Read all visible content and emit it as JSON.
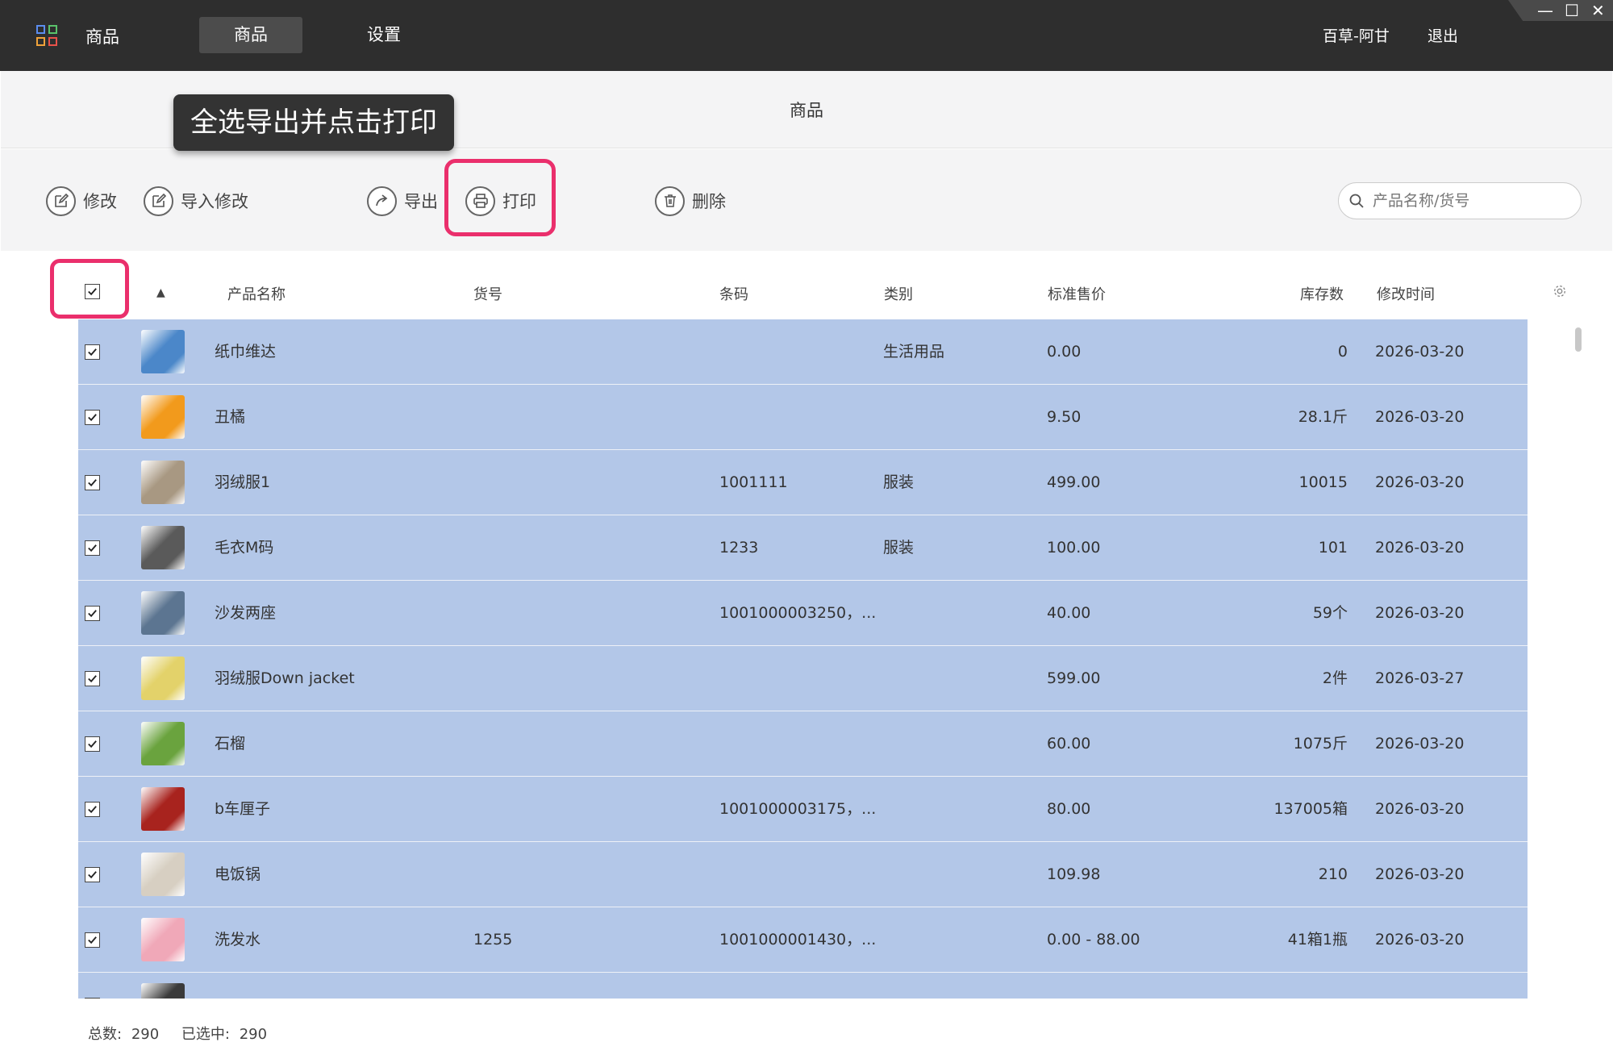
{
  "topbar": {
    "app_name": "商品",
    "tabs": [
      {
        "label": "商品",
        "active": true
      },
      {
        "label": "设置",
        "active": false
      }
    ],
    "user_name": "百草-阿甘",
    "logout_label": "退出",
    "window_controls": {
      "minimize": "—",
      "maximize": "☐",
      "close": "✕"
    }
  },
  "page": {
    "title": "商品",
    "tip_banner": "全选导出并点击打印"
  },
  "toolbar": {
    "edit_label": "修改",
    "import_edit_label": "导入修改",
    "export_label": "导出",
    "print_label": "打印",
    "delete_label": "删除",
    "search_placeholder": "产品名称/货号"
  },
  "table": {
    "sort_indicator": "▲",
    "headers": {
      "name": "产品名称",
      "sku": "货号",
      "barcode": "条码",
      "category": "类别",
      "price": "标准售价",
      "stock": "库存数",
      "modified": "修改时间"
    },
    "rows": [
      {
        "name": "纸巾维达",
        "sku": "",
        "barcode": "",
        "category": "生活用品",
        "price": "0.00",
        "stock": "0",
        "modified": "2026-03-20",
        "thumb_color": "#4b87c9",
        "checked": true
      },
      {
        "name": "丑橘",
        "sku": "",
        "barcode": "",
        "category": "",
        "price": "9.50",
        "stock": "28.1斤",
        "modified": "2026-03-20",
        "thumb_color": "#f29a1c",
        "checked": true
      },
      {
        "name": "羽绒服1",
        "sku": "",
        "barcode": "1001111",
        "category": "服装",
        "price": "499.00",
        "stock": "10015",
        "modified": "2026-03-20",
        "thumb_color": "#a89882",
        "checked": true
      },
      {
        "name": "毛衣M码",
        "sku": "",
        "barcode": "1233",
        "category": "服装",
        "price": "100.00",
        "stock": "101",
        "modified": "2026-03-20",
        "thumb_color": "#5a5a5a",
        "checked": true
      },
      {
        "name": "沙发两座",
        "sku": "",
        "barcode": "1001000003250，...",
        "category": "",
        "price": "40.00",
        "stock": "59个",
        "modified": "2026-03-20",
        "thumb_color": "#5c7591",
        "checked": true
      },
      {
        "name": "羽绒服Down jacket",
        "sku": "",
        "barcode": "",
        "category": "",
        "price": "599.00",
        "stock": "2件",
        "modified": "2026-03-27",
        "thumb_color": "#e3d26a",
        "checked": true
      },
      {
        "name": "石榴",
        "sku": "",
        "barcode": "",
        "category": "",
        "price": "60.00",
        "stock": "1075斤",
        "modified": "2026-03-20",
        "thumb_color": "#6aa33e",
        "checked": true
      },
      {
        "name": "b车厘子",
        "sku": "",
        "barcode": "1001000003175，...",
        "category": "",
        "price": "80.00",
        "stock": "137005箱",
        "modified": "2026-03-20",
        "thumb_color": "#a8231e",
        "checked": true
      },
      {
        "name": "电饭锅",
        "sku": "",
        "barcode": "",
        "category": "",
        "price": "109.98",
        "stock": "210",
        "modified": "2026-03-20",
        "thumb_color": "#d7cfc2",
        "checked": true
      },
      {
        "name": "洗发水",
        "sku": "1255",
        "barcode": "1001000001430，...",
        "category": "",
        "price": "0.00 - 88.00",
        "stock": "41箱1瓶",
        "modified": "2026-03-20",
        "thumb_color": "#f0a8b8",
        "checked": true
      },
      {
        "name": "",
        "sku": "",
        "barcode": "",
        "category": "",
        "price": "",
        "stock": "",
        "modified": "",
        "thumb_color": "#3a3a3a",
        "checked": true
      }
    ]
  },
  "footer": {
    "total_label": "总数:",
    "total_value": "290",
    "selected_label": "已选中:",
    "selected_value": "290"
  },
  "colors": {
    "topbar": "#2e2e2e",
    "selected_row": "#b3c7e8",
    "highlight": "#ea2f6c"
  }
}
